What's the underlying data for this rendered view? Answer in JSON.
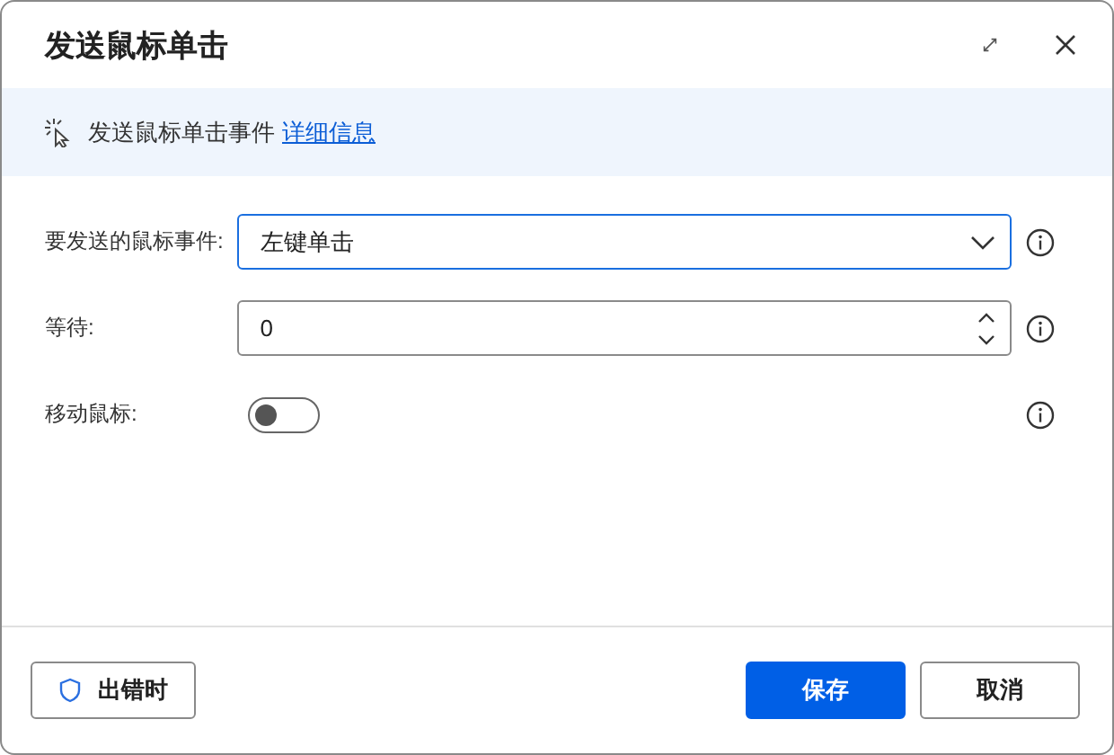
{
  "window": {
    "title": "发送鼠标单击"
  },
  "info": {
    "text": "发送鼠标单击事件",
    "link": "详细信息"
  },
  "fields": [
    {
      "kind": "dropdown",
      "label": "要发送的鼠标事件:",
      "value": "左键单击",
      "focused": true
    },
    {
      "kind": "number",
      "label": "等待:",
      "value": "0",
      "focused": false
    },
    {
      "kind": "toggle",
      "label": "移动鼠标:",
      "on": false
    }
  ],
  "footer": {
    "error_button": "出错时",
    "save": "保存",
    "cancel": "取消"
  }
}
